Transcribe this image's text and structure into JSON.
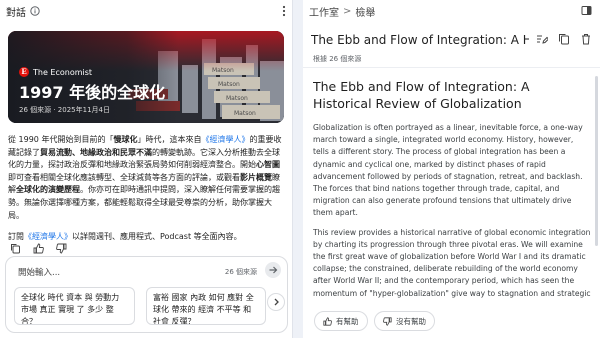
{
  "chat": {
    "title": "對話",
    "hero": {
      "source_name": "The Economist",
      "source_logo": "E",
      "title": "1997 年後的全球化",
      "meta": "26 個來源 · 2025年11月4日"
    },
    "summary": {
      "p1_a": "從 1990 年代開始到目前的「",
      "p1_b": "慢球化",
      "p1_c": "」時代，這本來自",
      "p1_link": "《經濟學人》",
      "p1_d": "的重要收藏記錄了",
      "p1_e": "貿易流動、地緣政治和民眾不滿",
      "p1_f": "的轉變軌跡。它深入分析推動去全球化的力量，探討政治反彈和地緣政治緊張局勢如何削弱經濟整合。開始",
      "p1_g": "心智圖",
      "p1_h": "即可查看相關全球化應該轉型、全球減貧等各方面的評論，或觀看",
      "p1_i": "影片概覽",
      "p1_j": "瞭解",
      "p1_k": "全球化的演變歷程",
      "p1_l": "。你亦可在即時通訊中提問，深入瞭解任何需要掌握的趨勢。無論你選擇哪種方案，都能輕鬆取得全球最受尊崇的分析，助你掌握大局。",
      "p2_a": "訂閱",
      "p2_link": "《經濟學人》",
      "p2_b": "以詳閱週刊、應用程式、Podcast 等全面內容。"
    },
    "input": {
      "placeholder": "開始輸入...",
      "source_count": "26 個來源"
    },
    "suggestions": [
      "全球化 時代 資本 與 勞動力 市場 真正 實現 了 多少 整合？",
      "富裕 國家 內政 如何 應對 全球化 帶來的 經濟 不平等 和 社會 反彈？"
    ]
  },
  "studio": {
    "breadcrumb_root": "工作室",
    "breadcrumb_sep": ">",
    "breadcrumb_current": "檢舉",
    "doc_title": "The Ebb and Flow of Integration: A Historical Review of Globalization",
    "doc_sub": "根據 26 個來源",
    "heading": "The Ebb and Flow of Integration: A Historical Review of Globalization",
    "paragraphs": [
      "Globalization is often portrayed as a linear, inevitable force, a one-way march toward a single, integrated world economy. History, however, tells a different story. The process of global integration has been a dynamic and cyclical one, marked by distinct phases of rapid advancement followed by periods of stagnation, retreat, and backlash. The forces that bind nations together through trade, capital, and migration can also generate profound tensions that ultimately drive them apart.",
      "This review provides a historical narrative of global economic integration by charting its progression through three pivotal eras. We will examine the first great wave of globalization before World War I and its dramatic collapse; the constrained, deliberate rebuilding of the world economy after World War II; and the contemporary period, which has seen the momentum of \"hyper-globalization\" give way to stagnation and strategic fragmentation."
    ],
    "feedback_yes": "有幫助",
    "feedback_no": "沒有幫助"
  },
  "colors": {
    "accent": "#1a73e8",
    "economist_red": "#e3120b"
  },
  "icons": [
    "info-icon",
    "more-vert-icon",
    "expand-icon",
    "edit-icon",
    "copy-icon",
    "delete-icon",
    "thumb-up-icon",
    "thumb-down-icon",
    "send-icon",
    "chevron-right-icon"
  ]
}
